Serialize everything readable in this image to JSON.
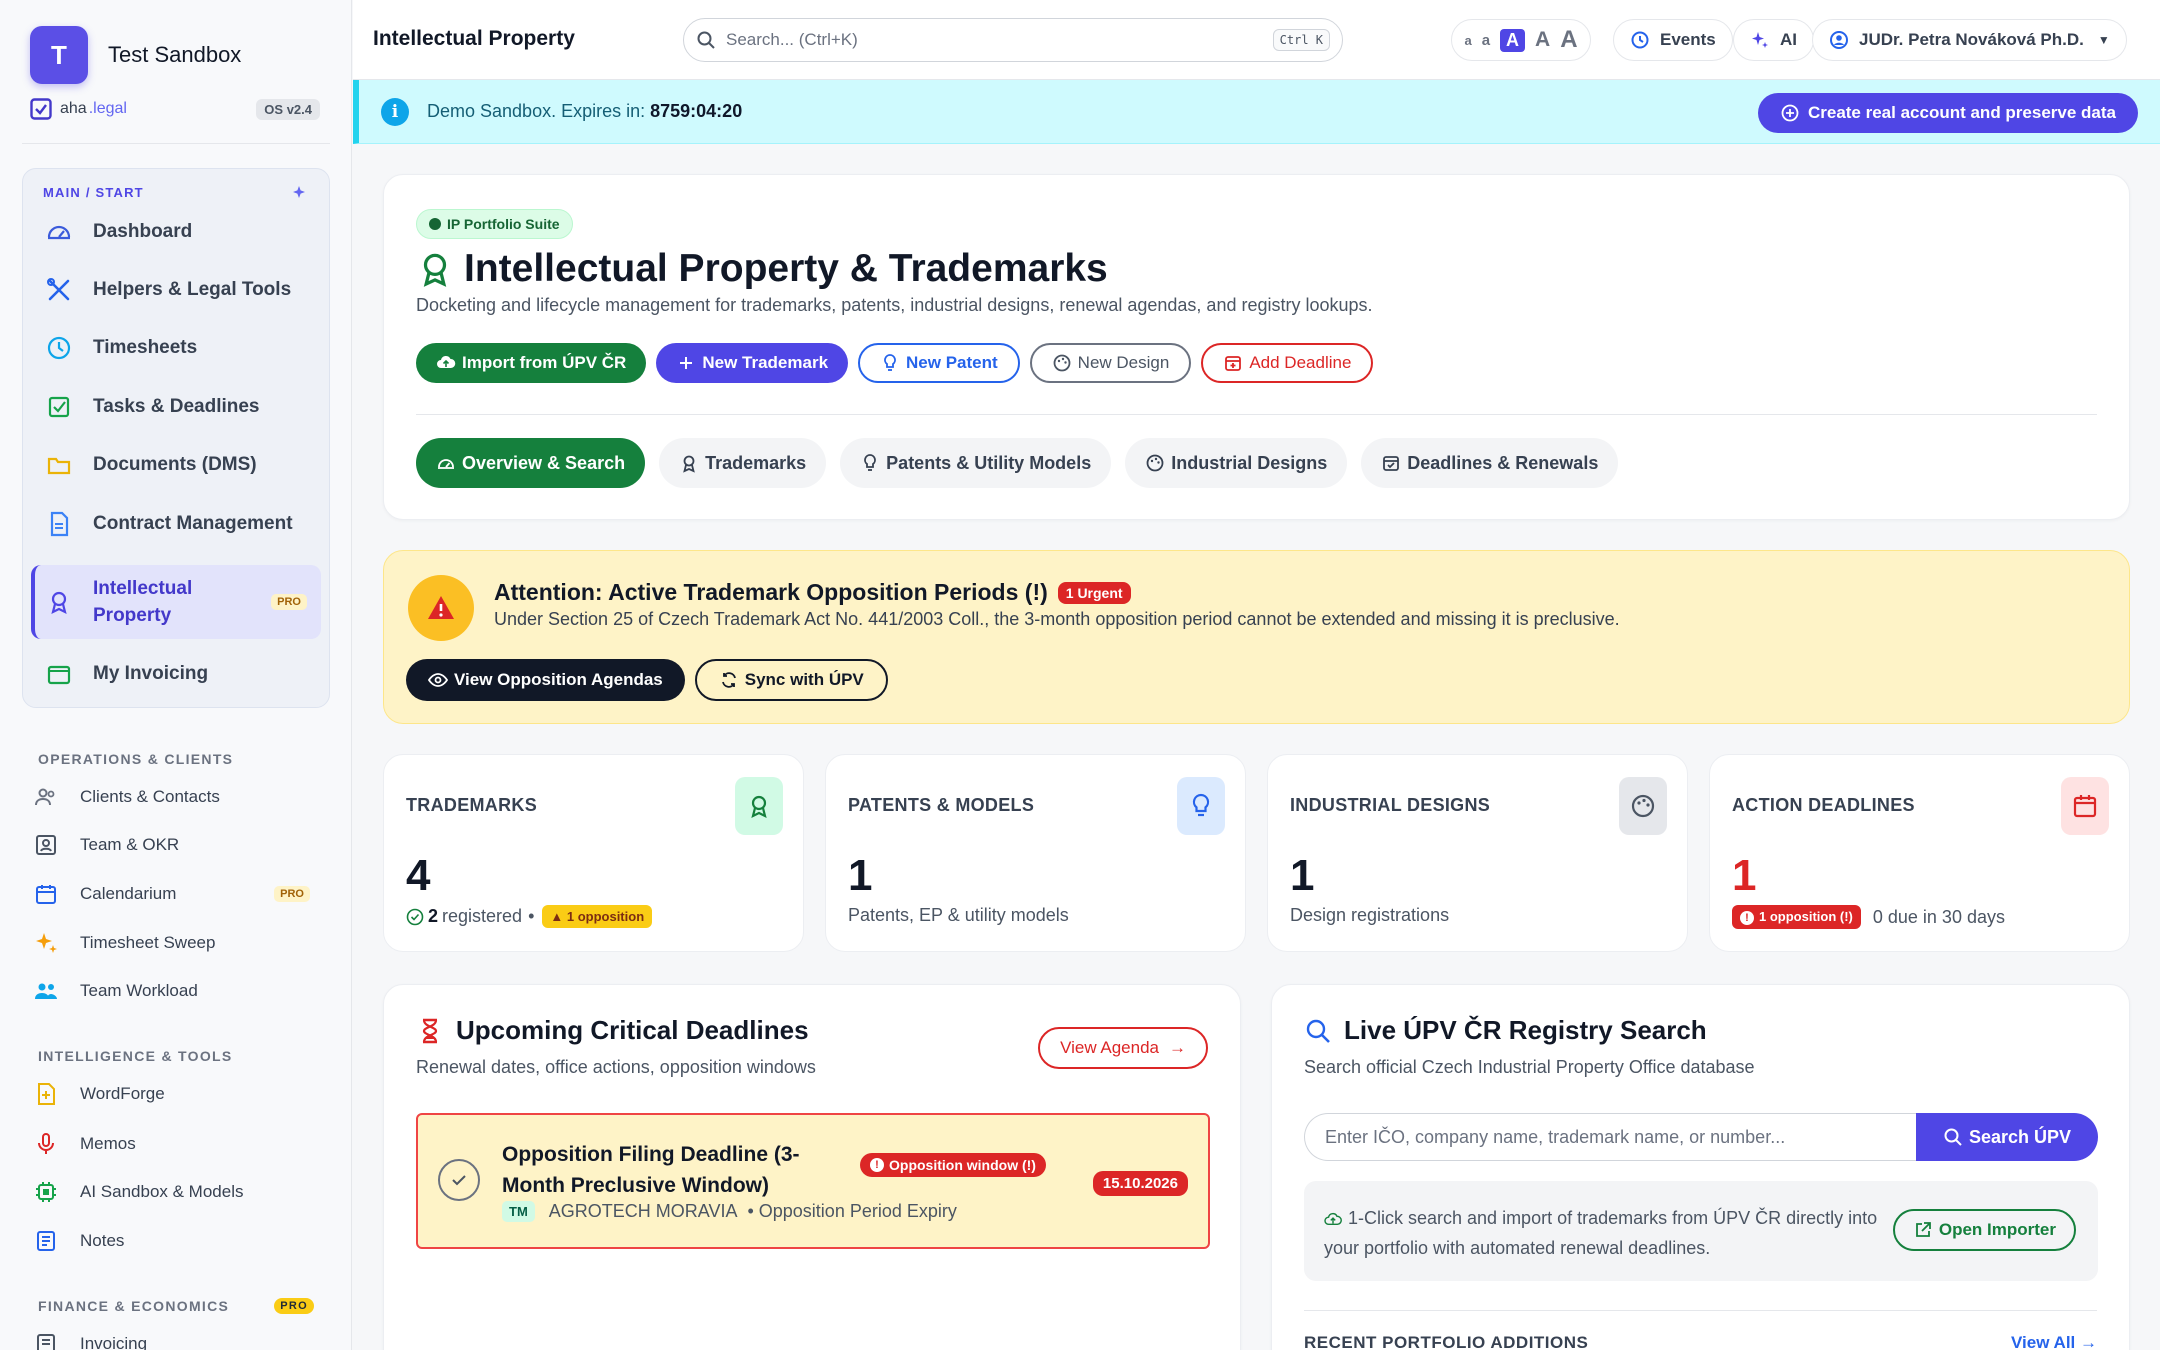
{
  "sidebar": {
    "brand_initial": "T",
    "brand_name": "Test Sandbox",
    "sub_brand": "aha",
    "sub_brand_accent": ".legal",
    "os_version": "OS v2.4",
    "main_section_title": "MAIN / START",
    "main_items": [
      {
        "label": "Dashboard",
        "icon": "gauge-icon"
      },
      {
        "label": "Helpers & Legal Tools",
        "icon": "tools-icon"
      },
      {
        "label": "Timesheets",
        "icon": "clock-icon"
      },
      {
        "label": "Tasks & Deadlines",
        "icon": "checkbox-icon"
      },
      {
        "label": "Documents (DMS)",
        "icon": "folder-icon"
      },
      {
        "label": "Contract Management",
        "icon": "document-icon"
      },
      {
        "label": "Intellectual Property",
        "icon": "award-icon",
        "badge": "PRO",
        "active": true
      },
      {
        "label": "My Invoicing",
        "icon": "wallet-icon"
      }
    ],
    "ops_title": "OPERATIONS & CLIENTS",
    "ops_items": [
      {
        "label": "Clients & Contacts",
        "icon": "users-icon"
      },
      {
        "label": "Team & OKR",
        "icon": "person-card-icon"
      },
      {
        "label": "Calendarium",
        "icon": "calendar-icon",
        "badge": "PRO"
      },
      {
        "label": "Timesheet Sweep",
        "icon": "sparkle-icon"
      },
      {
        "label": "Team Workload",
        "icon": "team-icon"
      }
    ],
    "intel_title": "INTELLIGENCE & TOOLS",
    "intel_items": [
      {
        "label": "WordForge",
        "icon": "file-plus-icon"
      },
      {
        "label": "Memos",
        "icon": "microphone-icon"
      },
      {
        "label": "AI Sandbox & Models",
        "icon": "chip-icon"
      },
      {
        "label": "Notes",
        "icon": "notes-icon"
      }
    ],
    "finance_title": "FINANCE & ECONOMICS",
    "finance_badge": "PRO",
    "finance_items": [
      {
        "label": "Invoicing",
        "icon": "invoice-icon"
      }
    ]
  },
  "topbar": {
    "title": "Intellectual Property",
    "search_placeholder": "Search... (Ctrl+K)",
    "search_shortcut": "Ctrl K",
    "font_sizes": [
      "a",
      "a",
      "A",
      "A",
      "A"
    ],
    "events_label": "Events",
    "ai_label": "AI",
    "user_name": "JUDr. Petra Nováková Ph.D."
  },
  "banner": {
    "text": "Demo Sandbox. Expires in:",
    "countdown": "8759:04:20",
    "cta": "Create real account and preserve data"
  },
  "hero": {
    "suite_badge": "IP Portfolio Suite",
    "title": "Intellectual Property & Trademarks",
    "subtitle": "Docketing and lifecycle management for trademarks, patents, industrial designs, renewal agendas, and registry lookups.",
    "buttons": {
      "import": "Import from ÚPV ČR",
      "new_trademark": "New Trademark",
      "new_patent": "New Patent",
      "new_design": "New Design",
      "add_deadline": "Add Deadline"
    },
    "tabs": [
      {
        "label": "Overview & Search",
        "icon": "gauge-icon",
        "active": true
      },
      {
        "label": "Trademarks",
        "icon": "award-icon"
      },
      {
        "label": "Patents & Utility Models",
        "icon": "bulb-icon"
      },
      {
        "label": "Industrial Designs",
        "icon": "palette-icon"
      },
      {
        "label": "Deadlines & Renewals",
        "icon": "calendar-check-icon"
      }
    ]
  },
  "attention": {
    "title": "Attention: Active Trademark Opposition Periods (!)",
    "badge": "1 Urgent",
    "text": "Under Section 25 of Czech Trademark Act No. 441/2003 Coll., the 3-month opposition period cannot be extended and missing it is preclusive.",
    "view_btn": "View Opposition Agendas",
    "sync_btn": "Sync with ÚPV"
  },
  "stats": {
    "trademarks": {
      "label": "TRADEMARKS",
      "value": "4",
      "registered_count": "2",
      "registered_label": "registered",
      "bullet": "•",
      "badge": "1 opposition"
    },
    "patents": {
      "label": "PATENTS & MODELS",
      "value": "1",
      "foot": "Patents, EP & utility models"
    },
    "designs": {
      "label": "INDUSTRIAL DESIGNS",
      "value": "1",
      "foot": "Design registrations"
    },
    "deadlines": {
      "label": "ACTION DEADLINES",
      "value": "1",
      "badge": "1 opposition (!)",
      "foot": "0 due in 30 days"
    }
  },
  "deadlines": {
    "title": "Upcoming Critical Deadlines",
    "subtitle": "Renewal dates, office actions, opposition windows",
    "view_agenda": "View Agenda",
    "item": {
      "title": "Opposition Filing Deadline (3-Month Preclusive Window)",
      "type_badge": "TM",
      "owner": "AGROTECH MORAVIA",
      "meta": "• Opposition Period Expiry",
      "window_badge": "Opposition window (!)",
      "date": "15.10.2026"
    }
  },
  "registry": {
    "title": "Live ÚPV ČR Registry Search",
    "subtitle": "Search official Czech Industrial Property Office database",
    "input_placeholder": "Enter IČO, company name, trademark name, or number...",
    "search_btn": "Search ÚPV",
    "importer_text": "1-Click search and import of trademarks from ÚPV ČR directly into your portfolio with automated renewal deadlines.",
    "importer_btn": "Open Importer",
    "recent_title": "RECENT PORTFOLIO ADDITIONS",
    "view_all": "View All →"
  },
  "colors": {
    "brand": "#4f46e5",
    "success": "#15803d",
    "danger": "#dc2626",
    "warning_bg": "#fef3c7",
    "info_bg": "#cffafe"
  }
}
